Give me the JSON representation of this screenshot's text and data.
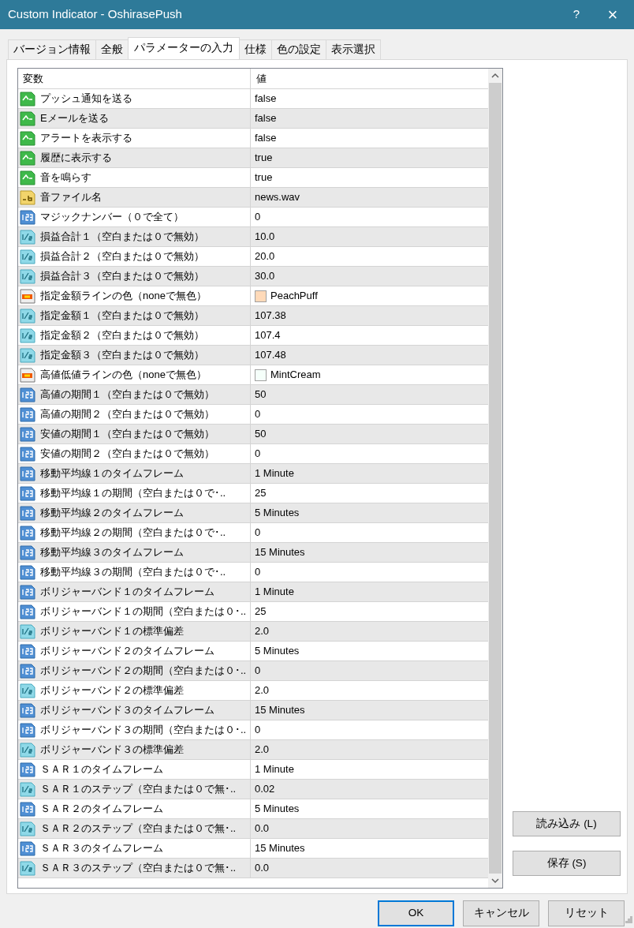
{
  "window": {
    "title": "Custom Indicator - OshirasePush",
    "help": "?",
    "close": "×"
  },
  "tabs": [
    {
      "label": "バージョン情報",
      "selected": false
    },
    {
      "label": "全般",
      "selected": false
    },
    {
      "label": "パラメーターの入力",
      "selected": true
    },
    {
      "label": "仕様",
      "selected": false
    },
    {
      "label": "色の設定",
      "selected": false
    },
    {
      "label": "表示選択",
      "selected": false
    }
  ],
  "grid": {
    "columns": [
      "変数",
      "値"
    ],
    "rows": [
      {
        "kind": "bool",
        "name": "プッシュ通知を送る",
        "value": "false"
      },
      {
        "kind": "bool",
        "name": "Eメールを送る",
        "value": "false"
      },
      {
        "kind": "bool",
        "name": "アラートを表示する",
        "value": "false"
      },
      {
        "kind": "bool",
        "name": "履歴に表示する",
        "value": "true"
      },
      {
        "kind": "bool",
        "name": "音を鳴らす",
        "value": "true"
      },
      {
        "kind": "string",
        "name": "音ファイル名",
        "value": "news.wav"
      },
      {
        "kind": "int",
        "name": "マジックナンバー（０で全て）",
        "value": "0"
      },
      {
        "kind": "double",
        "name": "損益合計１（空白または０で無効）",
        "value": "10.0"
      },
      {
        "kind": "double",
        "name": "損益合計２（空白または０で無効）",
        "value": "20.0"
      },
      {
        "kind": "double",
        "name": "損益合計３（空白または０で無効）",
        "value": "30.0"
      },
      {
        "kind": "color",
        "name": "指定金額ラインの色（noneで無色）",
        "value": "PeachPuff",
        "color": "#ffdab9"
      },
      {
        "kind": "double",
        "name": "指定金額１（空白または０で無効）",
        "value": "107.38"
      },
      {
        "kind": "double",
        "name": "指定金額２（空白または０で無効）",
        "value": "107.4"
      },
      {
        "kind": "double",
        "name": "指定金額３（空白または０で無効）",
        "value": "107.48"
      },
      {
        "kind": "color",
        "name": "高値低値ラインの色（noneで無色）",
        "value": "MintCream",
        "color": "#f5fffa"
      },
      {
        "kind": "int",
        "name": "高値の期間１（空白または０で無効）",
        "value": "50"
      },
      {
        "kind": "int",
        "name": "高値の期間２（空白または０で無効）",
        "value": "0"
      },
      {
        "kind": "int",
        "name": "安値の期間１（空白または０で無効）",
        "value": "50"
      },
      {
        "kind": "int",
        "name": "安値の期間２（空白または０で無効）",
        "value": "0"
      },
      {
        "kind": "int",
        "name": "移動平均線１のタイムフレーム",
        "value": "1 Minute"
      },
      {
        "kind": "int",
        "name": "移動平均線１の期間（空白または０で･..",
        "value": "25"
      },
      {
        "kind": "int",
        "name": "移動平均線２のタイムフレーム",
        "value": "5 Minutes"
      },
      {
        "kind": "int",
        "name": "移動平均線２の期間（空白または０で･..",
        "value": "0"
      },
      {
        "kind": "int",
        "name": "移動平均線３のタイムフレーム",
        "value": "15 Minutes"
      },
      {
        "kind": "int",
        "name": "移動平均線３の期間（空白または０で･..",
        "value": "0"
      },
      {
        "kind": "int",
        "name": "ボリジャーバンド１のタイムフレーム",
        "value": "1 Minute"
      },
      {
        "kind": "int",
        "name": "ボリジャーバンド１の期間（空白または０･..",
        "value": "25"
      },
      {
        "kind": "double",
        "name": "ボリジャーバンド１の標準偏差",
        "value": "2.0"
      },
      {
        "kind": "int",
        "name": "ボリジャーバンド２のタイムフレーム",
        "value": "5 Minutes"
      },
      {
        "kind": "int",
        "name": "ボリジャーバンド２の期間（空白または０･..",
        "value": "0"
      },
      {
        "kind": "double",
        "name": "ボリジャーバンド２の標準偏差",
        "value": "2.0"
      },
      {
        "kind": "int",
        "name": "ボリジャーバンド３のタイムフレーム",
        "value": "15 Minutes"
      },
      {
        "kind": "int",
        "name": "ボリジャーバンド３の期間（空白または０･..",
        "value": "0"
      },
      {
        "kind": "double",
        "name": "ボリジャーバンド３の標準偏差",
        "value": "2.0"
      },
      {
        "kind": "int",
        "name": "ＳＡＲ１のタイムフレーム",
        "value": "1 Minute"
      },
      {
        "kind": "double",
        "name": "ＳＡＲ１のステップ（空白または０で無･..",
        "value": "0.02"
      },
      {
        "kind": "int",
        "name": "ＳＡＲ２のタイムフレーム",
        "value": "5 Minutes"
      },
      {
        "kind": "double",
        "name": "ＳＡＲ２のステップ（空白または０で無･..",
        "value": "0.0"
      },
      {
        "kind": "int",
        "name": "ＳＡＲ３のタイムフレーム",
        "value": "15 Minutes"
      },
      {
        "kind": "double",
        "name": "ＳＡＲ３のステップ（空白または０で無･..",
        "value": "0.0"
      }
    ]
  },
  "side_buttons": [
    "読み込み (L)",
    "保存 (S)"
  ],
  "buttons": [
    {
      "label": "OK",
      "default": true
    },
    {
      "label": "キャンセル",
      "default": false
    },
    {
      "label": "リセット",
      "default": false
    }
  ]
}
